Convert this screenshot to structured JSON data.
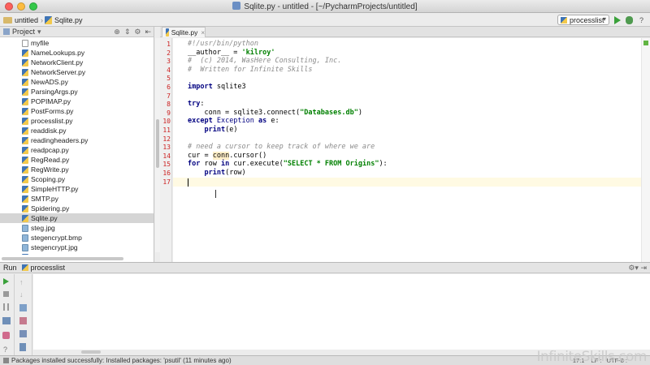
{
  "window": {
    "title": "Sqlite.py - untitled - [~/PycharmProjects/untitled]"
  },
  "nav": {
    "project": "untitled",
    "file": "Sqlite.py",
    "run_config": "processlist"
  },
  "project_panel": {
    "title": "Project",
    "files": [
      {
        "name": "myfile",
        "type": "plain"
      },
      {
        "name": "NameLookups.py",
        "type": "py"
      },
      {
        "name": "NetworkClient.py",
        "type": "py"
      },
      {
        "name": "NetworkServer.py",
        "type": "py"
      },
      {
        "name": "NewADS.py",
        "type": "py"
      },
      {
        "name": "ParsingArgs.py",
        "type": "py"
      },
      {
        "name": "POPIMAP.py",
        "type": "py"
      },
      {
        "name": "PostForms.py",
        "type": "py"
      },
      {
        "name": "processlist.py",
        "type": "py"
      },
      {
        "name": "readdisk.py",
        "type": "py"
      },
      {
        "name": "readingheaders.py",
        "type": "py"
      },
      {
        "name": "readpcap.py",
        "type": "py"
      },
      {
        "name": "RegRead.py",
        "type": "py"
      },
      {
        "name": "RegWrite.py",
        "type": "py"
      },
      {
        "name": "Scoping.py",
        "type": "py"
      },
      {
        "name": "SimpleHTTP.py",
        "type": "py"
      },
      {
        "name": "SMTP.py",
        "type": "py"
      },
      {
        "name": "Spidering.py",
        "type": "py"
      },
      {
        "name": "Sqlite.py",
        "type": "py",
        "selected": true
      },
      {
        "name": "steg.jpg",
        "type": "img"
      },
      {
        "name": "stegencrypt.bmp",
        "type": "img"
      },
      {
        "name": "stegencrypt.jpg",
        "type": "img"
      },
      {
        "name": "StegoEncrypt.py",
        "type": "py"
      }
    ]
  },
  "editor": {
    "tab": "Sqlite.py",
    "lines": [
      {
        "n": "1",
        "segs": [
          {
            "c": "c-comment",
            "t": "#!/usr/bin/python"
          }
        ]
      },
      {
        "n": "2",
        "segs": [
          {
            "c": "c-plain",
            "t": "__author__ = "
          },
          {
            "c": "c-str",
            "t": "'kilroy'"
          }
        ]
      },
      {
        "n": "3",
        "segs": [
          {
            "c": "c-comment",
            "t": "#  (c) 2014, WasHere Consulting, Inc."
          }
        ]
      },
      {
        "n": "4",
        "segs": [
          {
            "c": "c-comment",
            "t": "#  Written for Infinite Skills"
          }
        ]
      },
      {
        "n": "5",
        "segs": []
      },
      {
        "n": "6",
        "segs": [
          {
            "c": "c-kw",
            "t": "import"
          },
          {
            "c": "c-plain",
            "t": " sqlite3"
          }
        ]
      },
      {
        "n": "7",
        "segs": []
      },
      {
        "n": "8",
        "segs": [
          {
            "c": "c-kw",
            "t": "try"
          },
          {
            "c": "c-plain",
            "t": ":"
          }
        ]
      },
      {
        "n": "9",
        "segs": [
          {
            "c": "c-plain",
            "t": "    conn = sqlite3.connect("
          },
          {
            "c": "c-str",
            "t": "\"Databases.db\""
          },
          {
            "c": "c-plain",
            "t": ")"
          }
        ]
      },
      {
        "n": "10",
        "segs": [
          {
            "c": "c-kw",
            "t": "except"
          },
          {
            "c": "c-builtin",
            "t": " Exception "
          },
          {
            "c": "c-kw",
            "t": "as"
          },
          {
            "c": "c-plain",
            "t": " e:"
          }
        ]
      },
      {
        "n": "11",
        "segs": [
          {
            "c": "c-plain",
            "t": "    "
          },
          {
            "c": "c-kw",
            "t": "print"
          },
          {
            "c": "c-plain",
            "t": "(e)"
          }
        ]
      },
      {
        "n": "12",
        "segs": []
      },
      {
        "n": "13",
        "segs": [
          {
            "c": "c-comment",
            "t": "# need a cursor to keep track of where we are"
          }
        ]
      },
      {
        "n": "14",
        "segs": [
          {
            "c": "c-plain",
            "t": "cur = "
          },
          {
            "c": "c-plain c-hl",
            "t": "conn"
          },
          {
            "c": "c-plain",
            "t": ".cursor()"
          }
        ]
      },
      {
        "n": "15",
        "segs": [
          {
            "c": "c-kw",
            "t": "for"
          },
          {
            "c": "c-plain",
            "t": " row "
          },
          {
            "c": "c-kw",
            "t": "in"
          },
          {
            "c": "c-plain",
            "t": " cur.execute("
          },
          {
            "c": "c-str",
            "t": "\"SELECT * FROM Origins\""
          },
          {
            "c": "c-plain",
            "t": "):"
          }
        ]
      },
      {
        "n": "16",
        "segs": [
          {
            "c": "c-plain",
            "t": "    "
          },
          {
            "c": "c-kw",
            "t": "print"
          },
          {
            "c": "c-plain",
            "t": "(row)"
          }
        ]
      },
      {
        "n": "17",
        "segs": []
      }
    ]
  },
  "run_panel": {
    "label": "Run",
    "config": "processlist"
  },
  "status": {
    "message": "Packages installed successfully: Installed packages: 'psutil' (11 minutes ago)",
    "position": "17:1",
    "line_sep": "LF :",
    "encoding": "UTF-8 :"
  },
  "watermark": "InfiniteSkills.com"
}
